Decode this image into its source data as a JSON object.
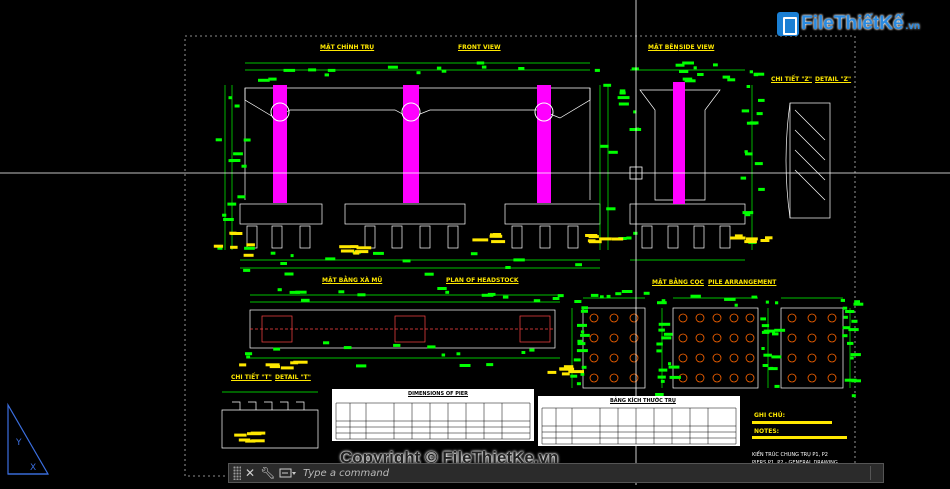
{
  "watermark": {
    "brand": "FileThiếtKế",
    "tld": ".vn",
    "copyright": "Copyright © FileThietKe.vn"
  },
  "drawing": {
    "labels": {
      "mat_chinh_tru": "MẶT CHÍNH TRỤ",
      "front_view": "FRONT VIEW",
      "mat_ben": "MẶT BÊN",
      "side_view": "SIDE VIEW",
      "chi_tiet_z": "CHI TIẾT \"Z\"",
      "detail_z": "DETAIL \"Z\"",
      "mat_bang_xa_mu": "MẶT BẰNG XÀ MŨ",
      "plan_of_headstock": "PLAN OF HEADSTOCK",
      "mat_bang_coc": "MẶT BẰNG CỌC",
      "pile_arrangement": "PILE ARRANGEMENT",
      "chi_tiet_t": "CHI TIẾT \"T\"",
      "detail_t": "DETAIL \"T\"",
      "ghi_chu": "GHI CHÚ:",
      "notes": "NOTES:"
    },
    "table1_title": "DIMENSIONS OF PIER",
    "table2_title": "BẢNG KÍCH THƯỚC TRỤ",
    "title_block_line1": "KIẾN TRÚC CHUNG TRỤ P1, P2",
    "title_block_line2": "PIERS P1, P2 - GENERAL DRAWING"
  },
  "colors": {
    "background": "#000000",
    "column_fill": "#ff00ff",
    "dimension": "#00ff00",
    "text": "#ffff00",
    "outline": "#ffffff",
    "pile": "#ff6600",
    "crosshair": "#ffffff"
  },
  "cmdline": {
    "placeholder": "Type a command",
    "close_icon": "close-icon",
    "settings_icon": "wrench-icon",
    "prompt_icon": "command-prompt-icon"
  }
}
